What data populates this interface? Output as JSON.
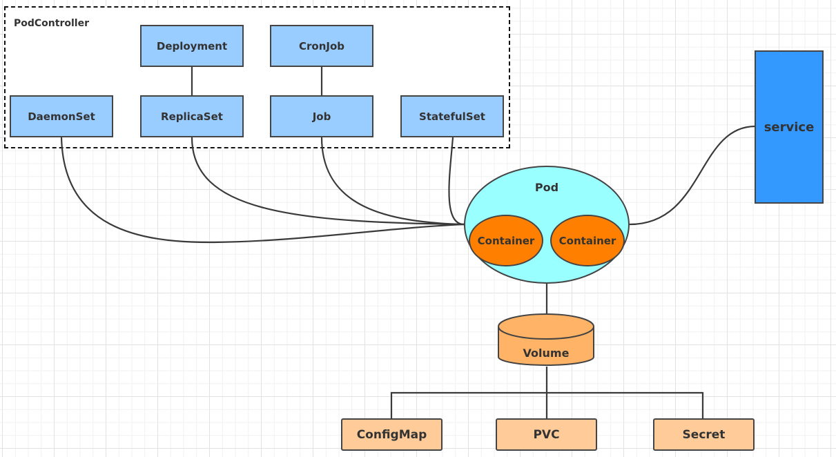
{
  "diagram": {
    "group": {
      "label": "PodController"
    },
    "controllers": {
      "deployment": "Deployment",
      "cronjob": "CronJob",
      "daemonset": "DaemonSet",
      "replicaset": "ReplicaSet",
      "job": "Job",
      "statefulset": "StatefulSet"
    },
    "pod": {
      "label": "Pod",
      "containers": [
        "Container",
        "Container"
      ]
    },
    "service": {
      "label": "service"
    },
    "volume": {
      "label": "Volume"
    },
    "volume_sources": [
      "ConfigMap",
      "PVC",
      "Secret"
    ],
    "edges": [
      {
        "from": "Deployment",
        "to": "ReplicaSet"
      },
      {
        "from": "CronJob",
        "to": "Job"
      },
      {
        "from": "DaemonSet",
        "to": "Pod"
      },
      {
        "from": "ReplicaSet",
        "to": "Pod"
      },
      {
        "from": "Job",
        "to": "Pod"
      },
      {
        "from": "StatefulSet",
        "to": "Pod"
      },
      {
        "from": "Pod",
        "to": "service"
      },
      {
        "from": "Pod",
        "to": "Volume"
      },
      {
        "from": "Volume",
        "to": "ConfigMap"
      },
      {
        "from": "Volume",
        "to": "PVC"
      },
      {
        "from": "Volume",
        "to": "Secret"
      }
    ],
    "colors": {
      "controller": "#99ccff",
      "service": "#3399ff",
      "pod": "#99ffff",
      "container": "#ff8000",
      "volume": "#ffb366",
      "volume_source": "#ffcc99",
      "stroke": "#444444"
    }
  }
}
